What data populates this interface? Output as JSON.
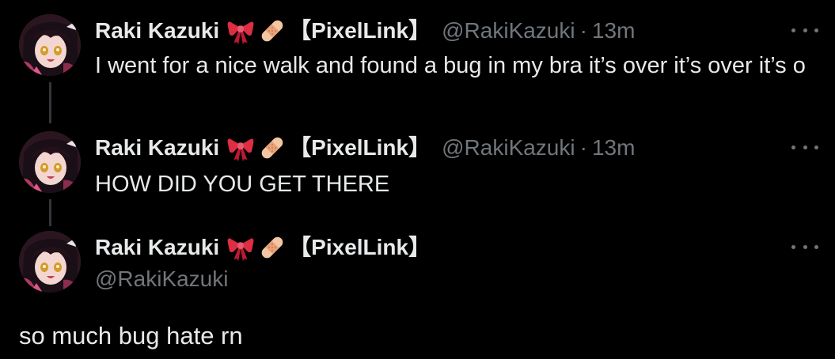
{
  "colors": {
    "background": "#000000",
    "primary_text": "#e7e9ea",
    "secondary_text": "#71767b",
    "thread_line": "#333639"
  },
  "user": {
    "display_name": "Raki Kazuki",
    "tag": "【PixelLink】",
    "handle": "@RakiKazuki",
    "name_emojis": [
      "ribbon-emoji",
      "bandage-emoji"
    ]
  },
  "tweets": [
    {
      "separator": "·",
      "time": "13m",
      "text": "I went for a nice walk and found a bug in my bra it’s over it’s over it’s o"
    },
    {
      "separator": "·",
      "time": "13m",
      "text": "HOW DID YOU GET THERE"
    }
  ],
  "main_tweet": {
    "text": "so much bug hate rn"
  }
}
